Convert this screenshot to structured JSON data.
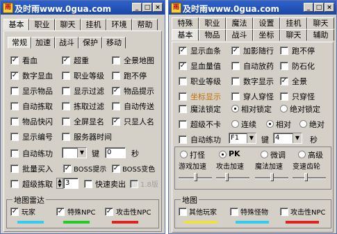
{
  "left": {
    "title": "及时雨www.0gua.com",
    "main_tabs": [
      "基本",
      "职业",
      "聊天",
      "挂机",
      "环境",
      "帮助"
    ],
    "sub_tabs": [
      "常规",
      "加速",
      "战斗",
      "保护",
      "移动"
    ],
    "rows": [
      [
        {
          "label": "看血",
          "checked": true
        },
        {
          "label": "超重",
          "checked": true
        },
        {
          "label": "全景地图",
          "checked": false
        }
      ],
      [
        {
          "label": "数字显血",
          "checked": true
        },
        {
          "label": "职业等级",
          "checked": false
        },
        {
          "label": "跑不停",
          "checked": false
        }
      ],
      [
        {
          "label": "显示物品",
          "checked": false
        },
        {
          "label": "显示过滤",
          "checked": false
        },
        {
          "label": "物品提示",
          "checked": true
        }
      ],
      [
        {
          "label": "自动拣取",
          "checked": false
        },
        {
          "label": "拣取过滤",
          "checked": false
        },
        {
          "label": "自动传送",
          "checked": false
        }
      ],
      [
        {
          "label": "物品快闪",
          "checked": false
        },
        {
          "label": "全屏显名",
          "checked": false
        },
        {
          "label": "只显人名",
          "checked": true
        }
      ],
      [
        {
          "label": "显示编号",
          "checked": false
        },
        {
          "label": "服务器时间",
          "checked": false
        }
      ]
    ],
    "auto_practice": {
      "label": "自动练功",
      "key_label": "键",
      "value": "0",
      "sec": "秒"
    },
    "row_batch": {
      "a": "批量买入",
      "b": "BOSS提示",
      "c": "BOSS变色",
      "b_checked": true,
      "c_checked": true
    },
    "row_super": {
      "label": "超级拣取",
      "value": "3",
      "quick": "快速卖出",
      "ver": "1.8版"
    },
    "radar": {
      "title": "地图雷达",
      "items": [
        {
          "label": "玩家",
          "checked": true,
          "color": "#33ccee"
        },
        {
          "label": "特殊NPC",
          "checked": true,
          "color": "#22cc22"
        },
        {
          "label": "攻击性NPC",
          "checked": true,
          "color": "#dd2222"
        }
      ]
    }
  },
  "right": {
    "title": "及时雨www.0gua.com",
    "tabs_row1": [
      "特殊",
      "职业",
      "魔法",
      "设置",
      "挂机",
      "聊天"
    ],
    "tabs_row2": [
      "基本",
      "物品",
      "战斗",
      "坐标",
      "聊天",
      "辅助"
    ],
    "rows": [
      [
        {
          "label": "显示血条",
          "checked": true
        },
        {
          "label": "加影随行",
          "checked": true
        },
        {
          "label": "跑不停",
          "checked": false
        }
      ],
      [
        {
          "label": "显血量值",
          "checked": true
        },
        {
          "label": "自动放药",
          "checked": false
        },
        {
          "label": "防石化",
          "checked": false
        }
      ],
      [
        {
          "label": "职业等级",
          "checked": false
        },
        {
          "label": "数字显示",
          "checked": false
        },
        {
          "label": "全景",
          "checked": true
        }
      ],
      [
        {
          "label": "坐标显示",
          "checked": false,
          "orange": true
        },
        {
          "label": "穿人穿怪",
          "checked": false
        },
        {
          "label": "只穿怪",
          "checked": false
        }
      ]
    ],
    "lock_row": {
      "label": "魔法锁定",
      "radio_mid": "相对锁定",
      "radio_right": "绝对锁定"
    },
    "super_row": {
      "label": "超级不卡",
      "r1": "连续",
      "r2": "相对",
      "r3": "绝对"
    },
    "practice_row": {
      "label": "自动练功",
      "f_key": "F1",
      "key_label": "键",
      "value": "4",
      "sec": "秒"
    },
    "mode": {
      "items": [
        "打怪",
        "PK",
        "微调",
        "高级"
      ],
      "selected": 1
    },
    "speed_labels": [
      "游戏加速",
      "攻击加速",
      "魔法加速",
      "变速齿轮"
    ],
    "speed_levels": [
      0.5,
      0.3,
      0.5,
      0.4
    ],
    "map": {
      "title": "地图",
      "items": [
        {
          "label": "其他玩家",
          "checked": false,
          "color": "#f0e040"
        },
        {
          "label": "特殊怪物",
          "checked": false,
          "color": "#33ccee"
        },
        {
          "label": "攻击性NPC",
          "checked": false,
          "color": "#dd2222"
        }
      ]
    }
  },
  "controls": {
    "min": "_",
    "max": "□",
    "close": "×"
  }
}
